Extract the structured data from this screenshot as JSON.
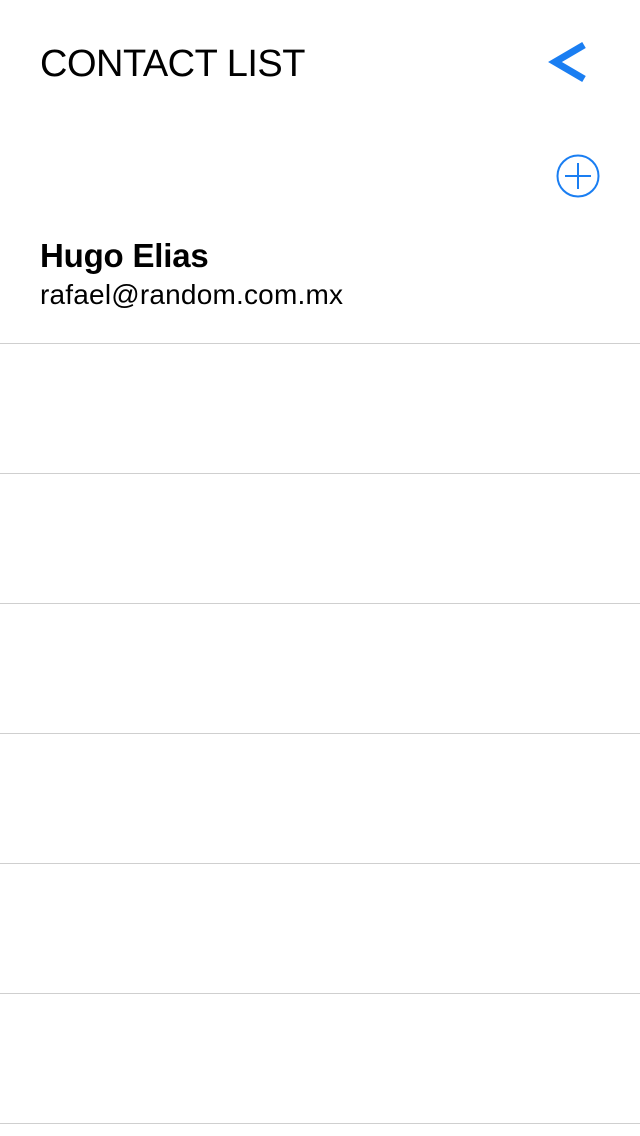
{
  "header": {
    "title": "CONTACT LIST",
    "back_icon": "chevron-left-icon",
    "add_icon": "plus-circle-icon"
  },
  "colors": {
    "accent": "#1a7ef2",
    "separator": "#cfcfcf",
    "text": "#000000",
    "background": "#ffffff"
  },
  "contacts": [
    {
      "name": "Hugo Elias",
      "email": "rafael@random.com.mx"
    },
    {
      "name": "",
      "email": ""
    },
    {
      "name": "",
      "email": ""
    },
    {
      "name": "",
      "email": ""
    },
    {
      "name": "",
      "email": ""
    },
    {
      "name": "",
      "email": ""
    },
    {
      "name": "",
      "email": ""
    }
  ]
}
